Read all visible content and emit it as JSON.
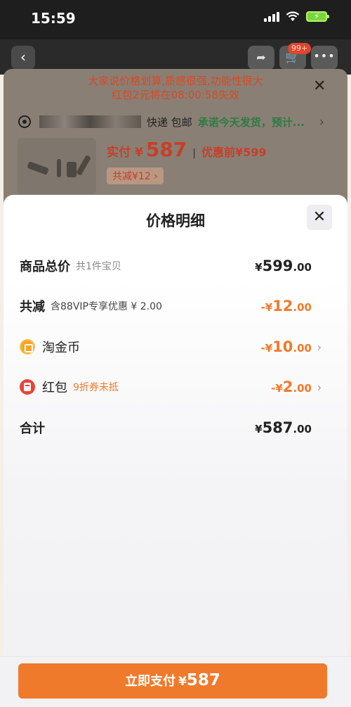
{
  "status_bar": {
    "time": "15:59"
  },
  "nav": {
    "back_icon": "chevron-left-icon",
    "share_icon": "share-icon",
    "cart_icon": "cart-icon",
    "cart_badge": "99+",
    "more_icon": "more-icon"
  },
  "background_sheet": {
    "notice_line1": "大家说价格划算,质感很强,功能性很大",
    "notice_line2": "红包2元将在08:00:58失效",
    "shipping": "快递 包邮",
    "promise": "承诺今天发货，预计...",
    "price_label": "实付",
    "price_symbol": "¥",
    "price_amount": "587",
    "original_price": "优惠前¥599",
    "discount_tag": "共减¥12 ›"
  },
  "price_detail": {
    "title": "价格明细",
    "close_icon": "close-icon",
    "rows": [
      {
        "label": "商品总价",
        "sub": "共1件宝贝",
        "symbol": "¥",
        "int": "599",
        "dec": ".00"
      },
      {
        "label": "共减",
        "sub": "含88VIP专享优惠 ¥ 2.00",
        "symbol": "-¥",
        "int": "12",
        "dec": ".00"
      },
      {
        "label": "淘金币",
        "sub": "",
        "symbol": "-¥",
        "int": "10",
        "dec": ".00",
        "icon": "coin-icon"
      },
      {
        "label": "红包",
        "sub": "9折券未抵",
        "symbol": "-¥",
        "int": "2",
        "dec": ".00",
        "icon": "red-packet-icon"
      },
      {
        "label": "合计",
        "sub": "",
        "symbol": "¥",
        "int": "587",
        "dec": ".00"
      }
    ]
  },
  "pay_button": {
    "label": "立即支付",
    "symbol": "¥",
    "amount": "587"
  },
  "colors": {
    "accent": "#f07a2b",
    "price_red": "#c5402a"
  }
}
